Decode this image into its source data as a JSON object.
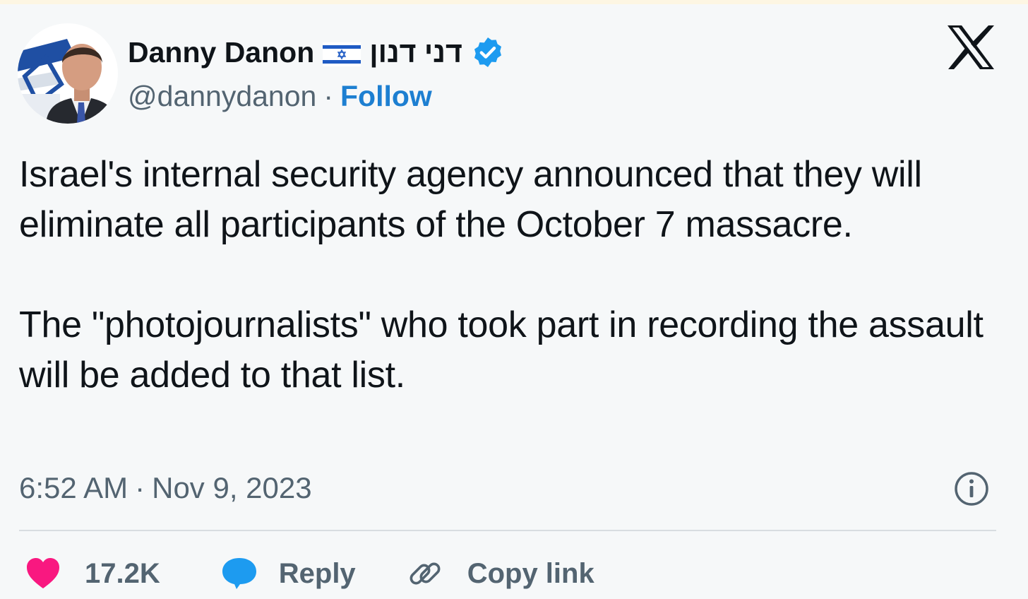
{
  "tweet": {
    "author": {
      "display_name": "Danny Danon",
      "hebrew_name": "דני דנון",
      "handle": "@dannydanon",
      "verified": true,
      "flag_icon": "israel-flag-icon",
      "verified_icon": "verified-badge-icon"
    },
    "separator": "·",
    "follow_label": "Follow",
    "text": "Israel's internal security agency announced that they will eliminate all participants of the October 7 massacre.\n\nThe \"photojournalists\" who took part in recording the assault will be added to that list.",
    "time": "6:52 AM",
    "date": "Nov 9, 2023",
    "likes": "17.2K",
    "reply_label": "Reply",
    "copy_link_label": "Copy link"
  },
  "icons": {
    "brand": "x-logo-icon",
    "info": "info-icon",
    "like": "heart-icon",
    "reply": "speech-bubble-icon",
    "copy": "link-icon"
  },
  "colors": {
    "background": "#f6f8f9",
    "follow": "#1d7fd1",
    "verified": "#1d9bf0",
    "heart": "#f91880",
    "reply_icon": "#1d9bf0",
    "muted_text": "#536471"
  }
}
